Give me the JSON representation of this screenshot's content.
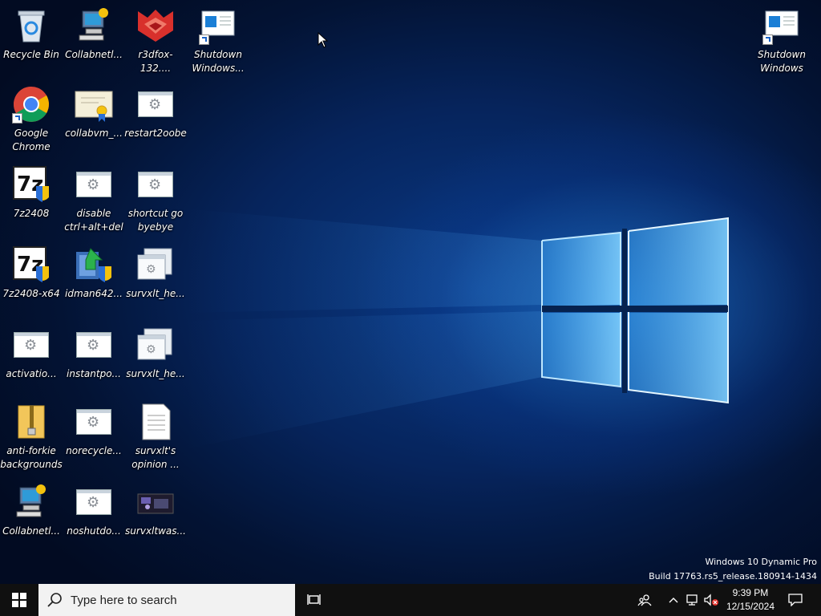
{
  "desktop": {
    "icons": [
      {
        "id": "recycle-bin",
        "label": "Recycle Bin",
        "icon": "recycle-bin-icon"
      },
      {
        "id": "collabnet-1",
        "label": "Collabnetl...",
        "icon": "network-computer-icon"
      },
      {
        "id": "r3dfox",
        "label": "r3dfox-132....",
        "icon": "r3dfox-icon"
      },
      {
        "id": "shutdown-1",
        "label": "Shutdown Windows...",
        "icon": "shutdown-window-icon"
      },
      {
        "id": "chrome",
        "label": "Google Chrome",
        "icon": "chrome-icon"
      },
      {
        "id": "collabvm",
        "label": "collabvm_...",
        "icon": "certificate-icon"
      },
      {
        "id": "restart2oobe",
        "label": "restart2oobe",
        "icon": "script-icon"
      },
      {
        "id": "7z2408",
        "label": "7z2408",
        "icon": "7zip-installer-icon"
      },
      {
        "id": "disable-cad",
        "label": "disable ctrl+alt+del",
        "icon": "script-icon"
      },
      {
        "id": "shortcut-go",
        "label": "shortcut go byebye",
        "icon": "script-icon"
      },
      {
        "id": "7z2408-x64",
        "label": "7z2408-x64",
        "icon": "7zip-installer-icon"
      },
      {
        "id": "idman",
        "label": "idman642...",
        "icon": "idm-installer-icon"
      },
      {
        "id": "survxlt-he-1",
        "label": "survxlt_he...",
        "icon": "script-window-icon"
      },
      {
        "id": "activation",
        "label": "activatio...",
        "icon": "script-icon"
      },
      {
        "id": "instantpo",
        "label": "instantpo...",
        "icon": "script-icon"
      },
      {
        "id": "survxlt-he-2",
        "label": "survxlt_he...",
        "icon": "script-window-icon"
      },
      {
        "id": "anti-forkie",
        "label": "anti-forkie backgrounds",
        "icon": "zip-folder-icon"
      },
      {
        "id": "norecycle",
        "label": "norecycle...",
        "icon": "script-icon"
      },
      {
        "id": "survxlt-opinion",
        "label": "survxlt's opinion ...",
        "icon": "text-file-icon"
      },
      {
        "id": "collabnet-2",
        "label": "Collabnetl...",
        "icon": "network-computer-icon"
      },
      {
        "id": "noshutdo",
        "label": "noshutdo...",
        "icon": "script-icon"
      },
      {
        "id": "survxltwas",
        "label": "survxltwas...",
        "icon": "image-thumbnail-icon"
      },
      {
        "id": "shutdown-2",
        "label": "Shutdown Windows",
        "icon": "shutdown-window-icon"
      }
    ],
    "watermark": {
      "line1": "Windows 10 Dynamic Pro",
      "line2": "Build 17763.rs5_release.180914-1434"
    }
  },
  "taskbar": {
    "start_icon": "windows-logo-icon",
    "search_placeholder": "Type here to search",
    "clock": {
      "time": "9:39 PM",
      "date": "12/15/2024"
    }
  },
  "colors": {
    "taskbar": "#101010",
    "search_bg": "#f2f2f2",
    "accent": "#1b63c6"
  }
}
